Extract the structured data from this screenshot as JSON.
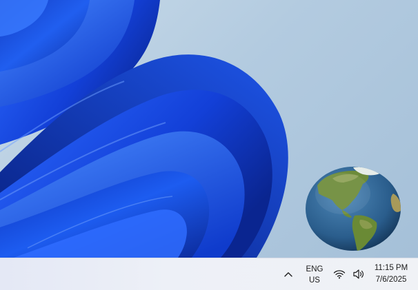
{
  "desktop": {
    "wallpaper": "windows-11-bloom",
    "accent_color": "#1a4fd6",
    "background_color": "#b7cde0"
  },
  "widgets": {
    "globe": {
      "icon": "globe-earth-icon",
      "colors": {
        "ocean": "#2a5d8c",
        "land": "#6d8b3a"
      }
    }
  },
  "taskbar": {
    "tray": {
      "overflow_icon": "chevron-up-icon",
      "language": {
        "line1": "ENG",
        "line2": "US"
      },
      "network_icon": "wifi-icon",
      "volume_icon": "speaker-icon"
    },
    "clock": {
      "time": "11:15 PM",
      "date": "7/6/2025"
    }
  }
}
